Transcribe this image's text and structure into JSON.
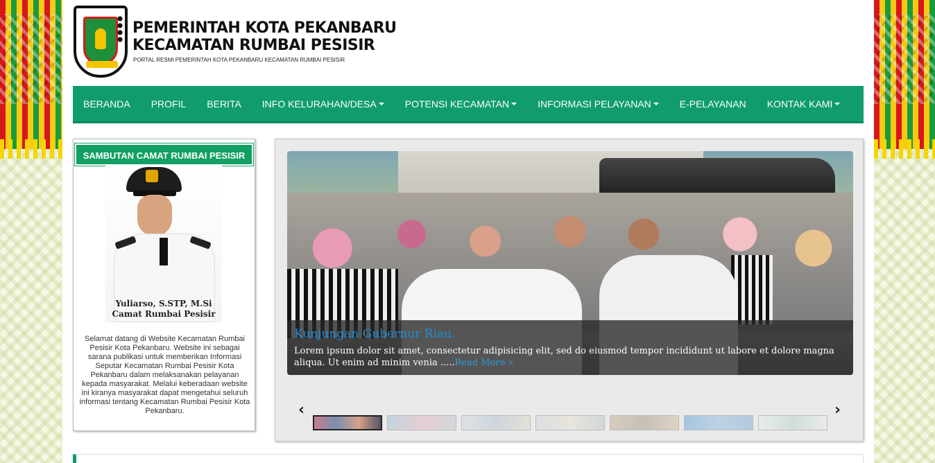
{
  "header": {
    "title_line1": "PEMERINTAH KOTA PEKANBARU",
    "title_line2": "KECAMATAN RUMBAI PESISIR",
    "subtitle": "PORTAL RESMI PEMERINTAH KOTA PEKANBARU KECAMATAN RUMBAI PESISIR"
  },
  "nav": {
    "items": [
      {
        "label": "BERANDA",
        "dropdown": false
      },
      {
        "label": "PROFIL",
        "dropdown": false
      },
      {
        "label": "BERITA",
        "dropdown": false
      },
      {
        "label": "INFO KELURAHAN/DESA",
        "dropdown": true
      },
      {
        "label": "POTENSI KECAMATAN",
        "dropdown": true
      },
      {
        "label": "INFORMASI PELAYANAN",
        "dropdown": true
      },
      {
        "label": "E-PELAYANAN",
        "dropdown": false
      },
      {
        "label": "KONTAK KAMI",
        "dropdown": true
      }
    ]
  },
  "sidebar": {
    "heading": "SAMBUTAN CAMAT RUMBAI PESISIR",
    "name": "Yuliarso, S.STP, M.Si",
    "position": "Camat Rumbai Pesisir",
    "text": "Selamat datang di Website Kecamatan Rumbai Pesisir Kota Pekanbaru. Website ini sebagai sarana publikasi untuk memberikan Informasi Seputar Kecamatan Rumbai Pesisir Kota Pekanbaru dalam melaksanakan pelayanan kepada masyarakat. Melalui keberadaan website ini kiranya masyarakat dapat mengetahui seluruh informasi tentang Kecamatan Rumbai Pesisir Kota Pekanbaru."
  },
  "slider": {
    "title": "Kunjungan Gubernur Riau.",
    "text": "Lorem ipsum dolor sit amet, consectetur adipisicing elit, sed do eiusmod tempor incididunt ut labore et dolore magna aliqua. Ut enim ad minim venia .....",
    "read_more": "Read More »",
    "prev": "‹",
    "next": "›"
  },
  "colors": {
    "nav_bg": "#109d6b",
    "sidebar_head": "#12a064",
    "caption_title": "#1d8fd8"
  }
}
